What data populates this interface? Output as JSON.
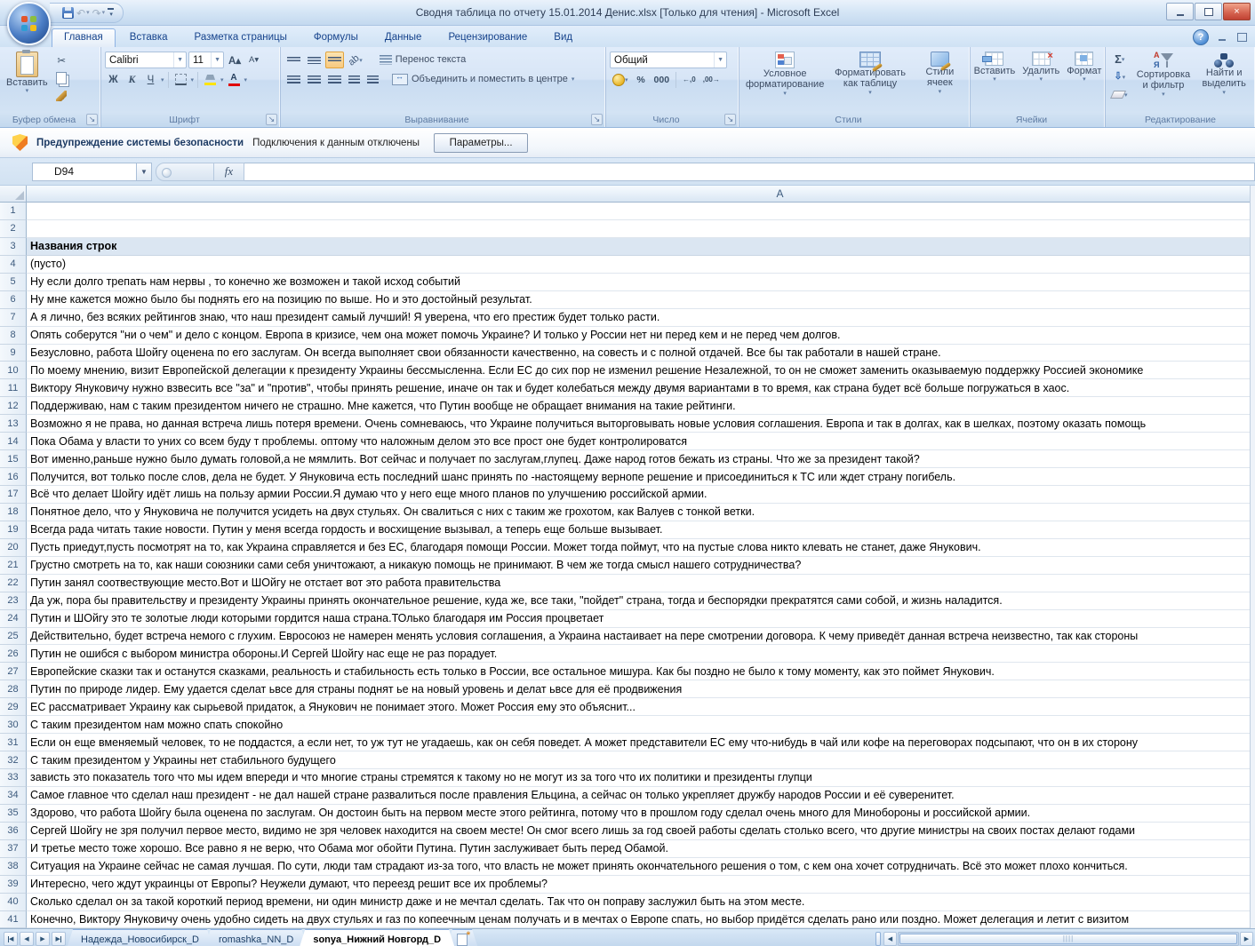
{
  "window": {
    "title": "Сводня таблица по отчету 15.01.2014 Денис.xlsx  [Только для чтения]  -  Microsoft Excel"
  },
  "ribbon_tabs": [
    {
      "label": "Главная"
    },
    {
      "label": "Вставка"
    },
    {
      "label": "Разметка страницы"
    },
    {
      "label": "Формулы"
    },
    {
      "label": "Данные"
    },
    {
      "label": "Рецензирование"
    },
    {
      "label": "Вид"
    }
  ],
  "ribbon": {
    "clipboard": {
      "paste_label": "Вставить",
      "group_label": "Буфер обмена"
    },
    "font": {
      "font_name": "Calibri",
      "font_size": "11",
      "bold": "Ж",
      "italic": "К",
      "underline": "Ч",
      "group_label": "Шрифт"
    },
    "alignment": {
      "wrap_text": "Перенос текста",
      "merge_center": "Объединить и поместить в центре",
      "group_label": "Выравнивание"
    },
    "number": {
      "format": "Общий",
      "percent": "%",
      "thousands": "000",
      "group_label": "Число"
    },
    "styles": {
      "conditional": "Условное форматирование",
      "format_table": "Форматировать как таблицу",
      "cell_styles": "Стили ячеек",
      "group_label": "Стили"
    },
    "cells": {
      "insert": "Вставить",
      "delete": "Удалить",
      "format": "Формат",
      "group_label": "Ячейки"
    },
    "editing": {
      "autosum": "Σ",
      "sort_filter": "Сортировка и фильтр",
      "find_select": "Найти и выделить",
      "group_label": "Редактирование"
    }
  },
  "security_bar": {
    "title": "Предупреждение системы безопасности",
    "message": "Подключения к данным отключены",
    "options_button": "Параметры..."
  },
  "formula_bar": {
    "name_box": "D94",
    "fx_label": "fx",
    "formula": ""
  },
  "grid": {
    "column_header": "A",
    "rows": [
      {
        "n": 1,
        "text": ""
      },
      {
        "n": 2,
        "text": ""
      },
      {
        "n": 3,
        "text": "Названия строк",
        "header": true
      },
      {
        "n": 4,
        "text": "(пусто)"
      },
      {
        "n": 5,
        "text": "Ну если долго трепать нам нервы , то конечно же возможен и такой исход событий"
      },
      {
        "n": 6,
        "text": "Ну мне кажется можно было бы поднять его на позицию по выше. Но и это достойный результат."
      },
      {
        "n": 7,
        "text": "А я лично, без всяких рейтингов знаю, что наш президент самый лучший! Я уверена, что его престиж будет только расти."
      },
      {
        "n": 8,
        "text": "Опять соберутся \"ни о чем\" и дело с концом. Европа в кризисе, чем она может помочь Украине? И только у России нет ни перед кем и не перед чем долгов."
      },
      {
        "n": 9,
        "text": "Безусловно, работа Шойгу оценена по его заслугам. Он всегда выполняет свои обязанности качественно, на совесть и с полной отдачей. Все бы так работали в нашей стране."
      },
      {
        "n": 10,
        "text": "По моему мнению, визит Европейской делегации к президенту Украины бессмысленна. Если ЕС до сих пор не изменил решение Незалежной, то он не сможет заменить оказываемую поддержку Россией экономике"
      },
      {
        "n": 11,
        "text": "Виктору Януковичу нужно взвесить все \"за\" и \"против\", чтобы принять решение, иначе он так и будет колебаться между двумя вариантами в то время, как страна будет всё больше погружаться в хаос."
      },
      {
        "n": 12,
        "text": "Поддерживаю, нам с таким президентом ничего не страшно. Мне кажется, что Путин вообще не обращает внимания на такие рейтинги."
      },
      {
        "n": 13,
        "text": "Возможно я не права, но данная встреча лишь потеря времени. Очень сомневаюсь, что Украине получиться выторговывать новые условия соглашения. Европа и так в долгах, как в шелках, поэтому оказать помощь"
      },
      {
        "n": 14,
        "text": "Пока Обама у власти то уних со всем буду т проблемы. оптому что наложным делом это все прост оне будет контролироватся"
      },
      {
        "n": 15,
        "text": "Вот именно,раньше нужно было думать головой,а не мямлить. Вот сейчас и получает по заслугам,глупец. Даже народ готов бежать из страны. Что же за президент такой?"
      },
      {
        "n": 16,
        "text": "Получится, вот только после слов, дела не будет. У Януковича есть последний шанс принять по -настоящему вернопе решение и присоединиться к ТС или ждет страну погибель."
      },
      {
        "n": 17,
        "text": "Всё что делает Шойгу идёт лишь на пользу армии России.Я думаю что у него еще много планов по улучшению российской армии."
      },
      {
        "n": 18,
        "text": "Понятное дело, что у Януковича не получится усидеть на двух стульях. Он свалиться с них с таким же грохотом, как Валуев с тонкой ветки."
      },
      {
        "n": 19,
        "text": "Всегда рада читать такие новости. Путин у меня всегда гордость и восхищение вызывал, а теперь еще больше вызывает."
      },
      {
        "n": 20,
        "text": "Пусть приедут,пусть посмотрят на то, как Украина справляется и без ЕС, благодаря помощи России. Может тогда поймут, что на пустые слова никто клевать не станет, даже Янукович."
      },
      {
        "n": 21,
        "text": "Грустно смотреть на то, как наши союзники сами себя уничтожают, а никакую помощь не принимают. В чем же тогда смысл нашего сотрудничества?"
      },
      {
        "n": 22,
        "text": "Путин занял соотвествующие место.Вот и ШОйгу не отстает вот это работа правительства"
      },
      {
        "n": 23,
        "text": "Да уж, пора бы правительству и президенту Украины принять окончательное решение, куда же, все таки, \"пойдет\" страна, тогда и беспорядки прекратятся сами собой, и жизнь наладится."
      },
      {
        "n": 24,
        "text": "Путин и ШОйгу это те золотые люди которыми гордится наша страна.ТОлько благодаря им Россия процветает"
      },
      {
        "n": 25,
        "text": "Действительно, будет встреча немого с глухим. Евросоюз не намерен менять условия соглашения, а Украина настаивает на пере смотрении договора. К чему приведёт данная встреча неизвестно, так как стороны"
      },
      {
        "n": 26,
        "text": "Путин не ошибся с выбором министра обороны.И Сергей Шойгу нас еще не раз порадует."
      },
      {
        "n": 27,
        "text": "Европейские сказки так и останутся сказками, реальность и стабильность есть только в России, все остальное мишура. Как бы поздно не было к тому моменту, как это поймет Янукович."
      },
      {
        "n": 28,
        "text": "Путин по природе лидер. Ему удается сделат ьвсе для страны поднят ье на новый уровень и делат ьвсе для её продвижения"
      },
      {
        "n": 29,
        "text": "ЕС рассматривает Украину как сырьевой придаток, а Янукович не понимает этого. Может Россия ему это объяснит..."
      },
      {
        "n": 30,
        "text": "С таким президентом нам можно спать спокойно"
      },
      {
        "n": 31,
        "text": "Если он еще вменяемый человек, то не поддастся, а если нет, то уж тут не угадаешь, как он себя поведет. А может представители ЕС ему что-нибудь в чай или кофе на переговорах подсыпают, что он в их сторону"
      },
      {
        "n": 32,
        "text": "С таким президентом у Украины нет стабильного будущего"
      },
      {
        "n": 33,
        "text": "зависть это показатель того что мы идем впереди и что многие страны стремятся к такому но не могут из за того что их политики и президенты глупци"
      },
      {
        "n": 34,
        "text": "Самое главное что сделал наш президент - не дал нашей стране развалиться после правления Ельцина, а сейчас он только укрепляет дружбу народов России и её суверенитет."
      },
      {
        "n": 35,
        "text": "Здорово, что работа Шойгу была оценена по заслугам. Он достоин быть на первом месте этого рейтинга, потому что в прошлом году сделал очень много для Минобороны и российской армии."
      },
      {
        "n": 36,
        "text": "Сергей Шойгу не зря получил первое место, видимо не зря человек находится на своем месте! Он смог всего лишь за год своей работы сделать столько всего, что другие министры на своих постах делают годами"
      },
      {
        "n": 37,
        "text": "И третье место тоже хорошо. Все равно я не верю, что Обама мог обойти Путина. Путин заслуживает быть перед Обамой."
      },
      {
        "n": 38,
        "text": "Ситуация на Украине сейчас не самая лучшая. По сути, люди там страдают из-за того, что власть не может принять окончательного решения о том, с кем она хочет сотрудничать. Всё это может плохо кончиться."
      },
      {
        "n": 39,
        "text": "Интересно, чего ждут украинцы от Европы? Неужели думают, что переезд решит все их проблемы?"
      },
      {
        "n": 40,
        "text": "Сколько сделал он за такой короткий период времени, ни один министр даже и не мечтал сделать. Так что он поправу заслужил быть на этом месте."
      },
      {
        "n": 41,
        "text": "Конечно, Виктору Януковичу очень удобно сидеть на двух стульях и газ по копеечным ценам получать и в мечтах о Европе спать, но выбор придётся сделать рано или поздно. Может делегация и летит с визитом"
      }
    ]
  },
  "sheet_bar": {
    "tabs": [
      {
        "label": "Надежда_Новосибирск_D"
      },
      {
        "label": "romashka_NN_D"
      },
      {
        "label": "sonya_Нижний Новгорд_D",
        "active": true
      }
    ]
  }
}
